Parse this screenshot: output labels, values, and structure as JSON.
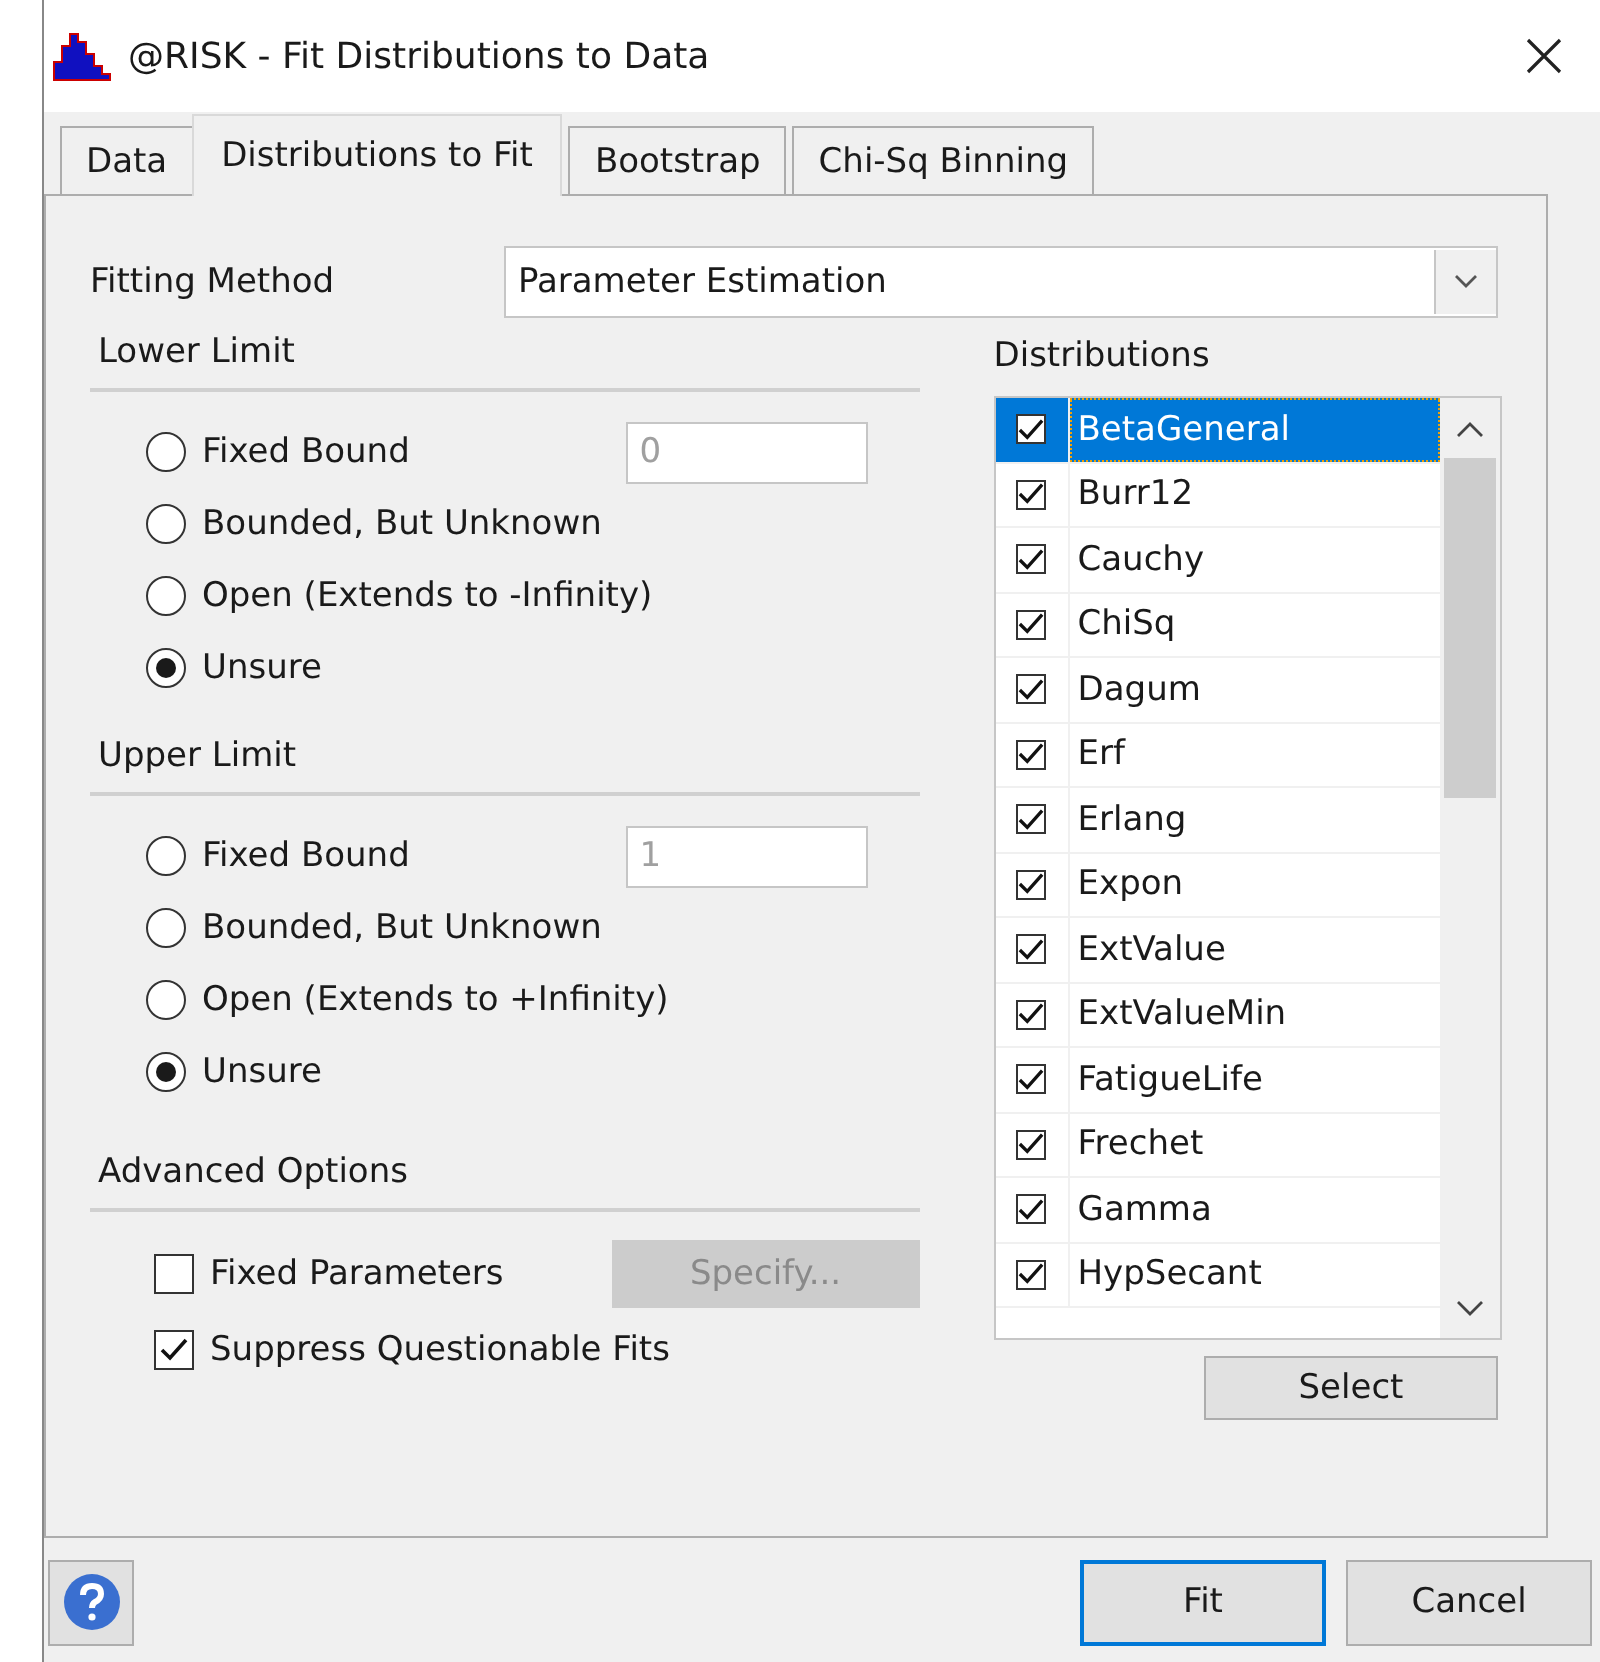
{
  "window": {
    "title": "@RISK - Fit Distributions to Data"
  },
  "tabs": [
    {
      "label": "Data",
      "selected": false
    },
    {
      "label": "Distributions to Fit",
      "selected": true
    },
    {
      "label": "Bootstrap",
      "selected": false
    },
    {
      "label": "Chi-Sq Binning",
      "selected": false
    }
  ],
  "fitting_method": {
    "label": "Fitting Method",
    "value": "Parameter Estimation"
  },
  "limits": [
    {
      "title": "Lower Limit",
      "bound_value": "0",
      "bound_disabled": true,
      "options": [
        {
          "label": "Fixed Bound",
          "selected": false
        },
        {
          "label": "Bounded, But Unknown",
          "selected": false
        },
        {
          "label": "Open (Extends to -Infinity)",
          "selected": false
        },
        {
          "label": "Unsure",
          "selected": true
        }
      ]
    },
    {
      "title": "Upper Limit",
      "bound_value": "1",
      "bound_disabled": true,
      "options": [
        {
          "label": "Fixed Bound",
          "selected": false
        },
        {
          "label": "Bounded, But Unknown",
          "selected": false
        },
        {
          "label": "Open (Extends to +Infinity)",
          "selected": false
        },
        {
          "label": "Unsure",
          "selected": true
        }
      ]
    }
  ],
  "advanced_options": {
    "title": "Advanced Options",
    "options": [
      {
        "label": "Fixed Parameters",
        "checked": false
      },
      {
        "label": "Suppress Questionable Fits",
        "checked": true
      }
    ],
    "specify_button": {
      "label": "Specify...",
      "disabled": true
    }
  },
  "distributions": {
    "title": "Distributions",
    "items": [
      {
        "name": "BetaGeneral",
        "checked": true,
        "selected": true
      },
      {
        "name": "Burr12",
        "checked": true,
        "selected": false
      },
      {
        "name": "Cauchy",
        "checked": true,
        "selected": false
      },
      {
        "name": "ChiSq",
        "checked": true,
        "selected": false
      },
      {
        "name": "Dagum",
        "checked": true,
        "selected": false
      },
      {
        "name": "Erf",
        "checked": true,
        "selected": false
      },
      {
        "name": "Erlang",
        "checked": true,
        "selected": false
      },
      {
        "name": "Expon",
        "checked": true,
        "selected": false
      },
      {
        "name": "ExtValue",
        "checked": true,
        "selected": false
      },
      {
        "name": "ExtValueMin",
        "checked": true,
        "selected": false
      },
      {
        "name": "FatigueLife",
        "checked": true,
        "selected": false
      },
      {
        "name": "Frechet",
        "checked": true,
        "selected": false
      },
      {
        "name": "Gamma",
        "checked": true,
        "selected": false
      },
      {
        "name": "HypSecant",
        "checked": true,
        "selected": false
      }
    ],
    "select_button": "Select"
  },
  "buttons": [
    {
      "label": "Fit",
      "default": true
    },
    {
      "label": "Cancel",
      "default": false
    }
  ]
}
